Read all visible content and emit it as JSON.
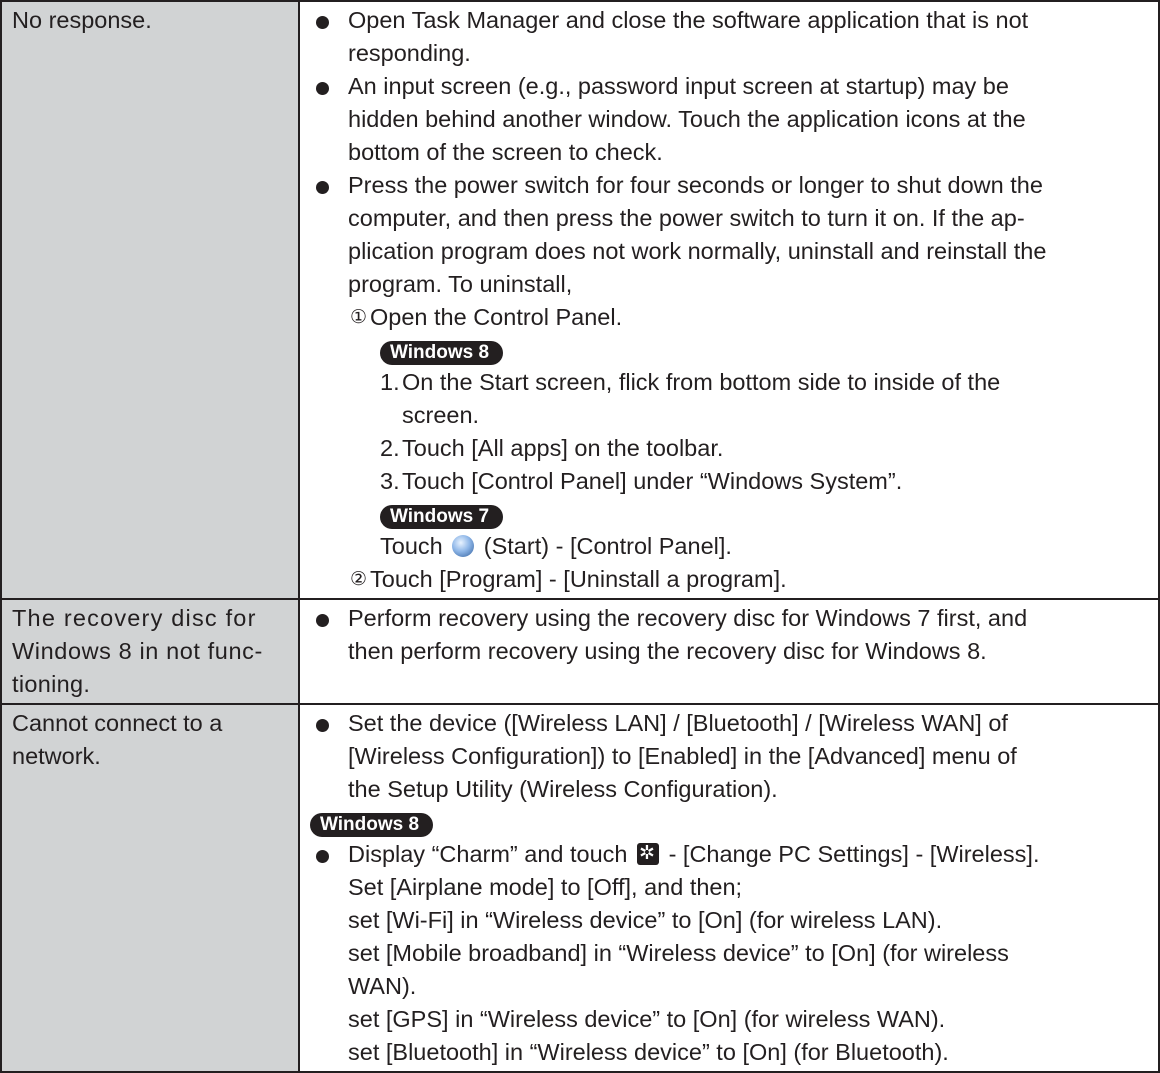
{
  "rows": [
    {
      "symptom": "No response.",
      "bullets": [
        [
          "Open Task Manager and close the software application that is not",
          "responding."
        ],
        [
          "An input screen (e.g., password input screen at startup) may be",
          "hidden behind another window. Touch the application icons at the",
          "bottom of the screen to check."
        ],
        [
          "Press the power switch for four seconds or longer to shut down the",
          "computer, and then press the power switch to turn it on. If the ap-",
          "plication program does not work normally, uninstall and reinstall the",
          "program. To uninstall,"
        ]
      ],
      "step1_mark": "①",
      "step1": "Open the Control Panel.",
      "badge_win8": "Windows 8",
      "win8_steps": [
        {
          "num": "1.",
          "lines": [
            "On the Start screen, flick from bottom side to inside of the",
            "screen."
          ]
        },
        {
          "num": "2.",
          "lines": [
            "Touch [All apps] on the toolbar."
          ]
        },
        {
          "num": "3.",
          "lines": [
            "Touch [Control Panel] under “Windows System”."
          ]
        }
      ],
      "badge_win7": "Windows 7",
      "win7_pre": "Touch",
      "win7_post": "(Start) - [Control Panel].",
      "step2_mark": "②",
      "step2": "Touch [Program] - [Uninstall a program]."
    },
    {
      "symptom_lines": [
        "The recovery disc for",
        "Windows 8 in not func-",
        "tioning."
      ],
      "bullet_lines": [
        "Perform recovery using the recovery disc for Windows 7 first, and",
        "then perform recovery using the recovery disc for Windows 8."
      ]
    },
    {
      "symptom_lines": [
        "Cannot connect to a",
        "network."
      ],
      "bullet1": [
        "Set the device ([Wireless LAN] / [Bluetooth] / [Wireless WAN] of",
        "[Wireless Configuration]) to [Enabled] in the [Advanced] menu of",
        "the Setup Utility (Wireless Configuration)."
      ],
      "badge_win8": "Windows 8",
      "bullet2_pre": "Display “Charm” and touch",
      "bullet2_post": "- [Change PC Settings] - [Wireless].",
      "bullet2_more": [
        "Set [Airplane mode] to [Off], and then;",
        "set [Wi-Fi] in “Wireless device” to [On] (for wireless LAN).",
        "set [Mobile broadband] in “Wireless device” to [On] (for wireless",
        "WAN).",
        "set [GPS] in “Wireless device” to [On] (for wireless WAN).",
        "set [Bluetooth] in “Wireless device” to [On] (for Bluetooth)."
      ]
    }
  ]
}
